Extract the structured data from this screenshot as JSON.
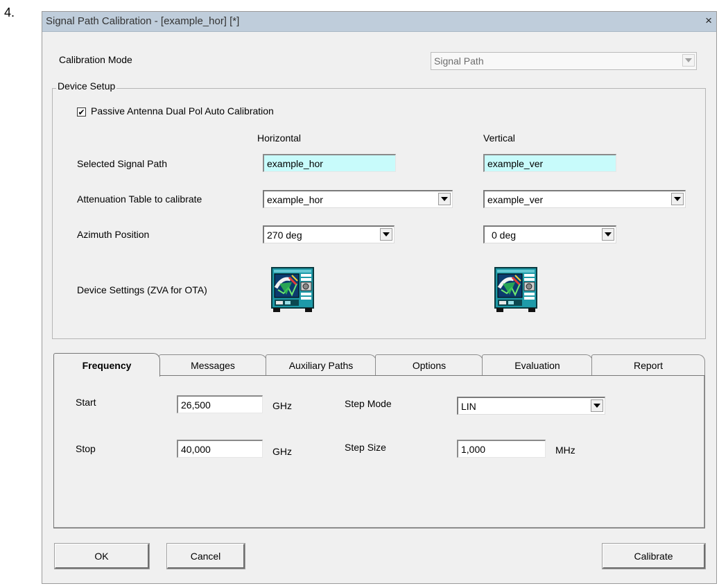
{
  "step_number": "4.",
  "window": {
    "title": "Signal Path Calibration - [example_hor] [*]",
    "close_glyph": "×"
  },
  "calibration_mode": {
    "label": "Calibration Mode",
    "value": "Signal Path"
  },
  "device_setup": {
    "legend": "Device Setup",
    "auto_calibration": {
      "label": "Passive Antenna Dual Pol Auto Calibration",
      "checked": true,
      "check_glyph": "✔"
    },
    "col_horizontal": "Horizontal",
    "col_vertical": "Vertical",
    "selected_signal_path": {
      "label": "Selected Signal Path",
      "horizontal": "example_hor",
      "vertical": "example_ver"
    },
    "attenuation_table": {
      "label": "Attenuation Table to calibrate",
      "horizontal": "example_hor",
      "vertical": "example_ver"
    },
    "azimuth_position": {
      "label": "Azimuth Position",
      "horizontal": "270 deg",
      "vertical": "0 deg"
    },
    "device_settings": {
      "label": "Device Settings (ZVA for OTA)",
      "icon": "network-analyzer-icon"
    }
  },
  "tabs": [
    "Frequency",
    "Messages",
    "Auxiliary Paths",
    "Options",
    "Evaluation",
    "Report"
  ],
  "active_tab": "Frequency",
  "frequency": {
    "start": {
      "label": "Start",
      "value": "26,500",
      "unit": "GHz"
    },
    "stop": {
      "label": "Stop",
      "value": "40,000",
      "unit": "GHz"
    },
    "step_mode": {
      "label": "Step Mode",
      "value": "LIN"
    },
    "step_size": {
      "label": "Step Size",
      "value": "1,000",
      "unit": "MHz"
    }
  },
  "buttons": {
    "ok": "OK",
    "cancel": "Cancel",
    "calibrate": "Calibrate"
  },
  "colors": {
    "titlebar": "#bfcddb",
    "dialog_bg": "#f0f0f0",
    "readonly_field": "#c8fbfb",
    "icon_teal": "#1e9aa8"
  }
}
